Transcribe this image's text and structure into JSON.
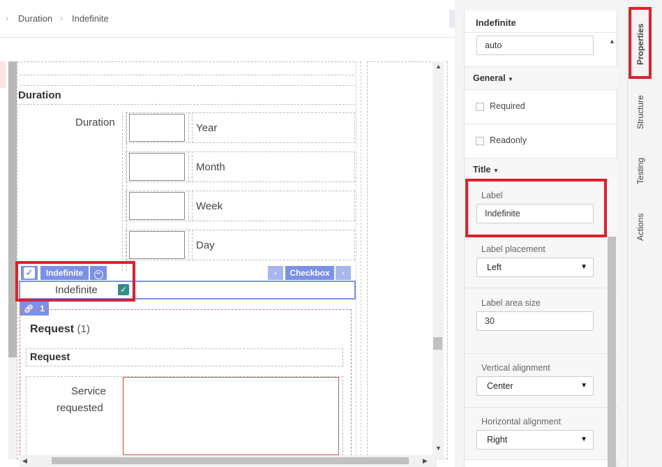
{
  "breadcrumb": {
    "items": [
      "Duration",
      "Indefinite"
    ]
  },
  "canvas": {
    "duration_section_title": "Duration",
    "duration_label": "Duration",
    "units": [
      "Year",
      "Month",
      "Week",
      "Day"
    ],
    "selected_field": {
      "toolbar_name": "Indefinite",
      "type_label": "Checkbox",
      "label": "Indefinite",
      "checked": true
    },
    "link_badge_count": "1",
    "request_section": {
      "title": "Request",
      "count": "(1)",
      "subsection_title": "Request",
      "service_label_line1": "Service",
      "service_label_line2": "requested"
    }
  },
  "panel": {
    "header": "Indefinite",
    "width_value": "auto",
    "general_label": "General",
    "required_label": "Required",
    "readonly_label": "Readonly",
    "title_label": "Title",
    "label_field_label": "Label",
    "label_field_value": "Indefinite",
    "label_placement_label": "Label placement",
    "label_placement_value": "Left",
    "label_area_size_label": "Label area size",
    "label_area_size_value": "30",
    "vertical_alignment_label": "Vertical alignment",
    "vertical_alignment_value": "Center",
    "horizontal_alignment_label": "Horizontal alignment",
    "horizontal_alignment_value": "Right"
  },
  "tabs": [
    "Properties",
    "Structure",
    "Testing",
    "Actions"
  ],
  "colors": {
    "accent_blue": "#7b90e8",
    "highlight_red": "#e0202a",
    "checkbox_teal": "#2f8f86"
  }
}
